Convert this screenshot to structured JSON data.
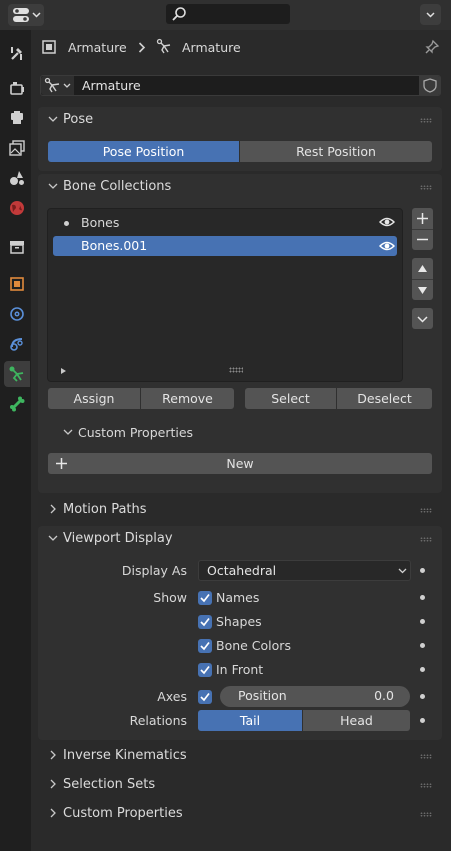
{
  "breadcrumb": {
    "object": "Armature",
    "data": "Armature"
  },
  "datablock": {
    "name": "Armature"
  },
  "pose": {
    "title": "Pose",
    "buttons": [
      "Pose Position",
      "Rest Position"
    ],
    "selected": "Pose Position"
  },
  "bone_collections": {
    "title": "Bone Collections",
    "items": [
      {
        "name": "Bones",
        "selected": false,
        "visible": true
      },
      {
        "name": "Bones.001",
        "selected": true,
        "visible": true
      }
    ],
    "assign_label": "Assign",
    "remove_label": "Remove",
    "select_label": "Select",
    "deselect_label": "Deselect",
    "custom_props_title": "Custom Properties",
    "new_label": "New"
  },
  "motion_paths": {
    "title": "Motion Paths"
  },
  "viewport_display": {
    "title": "Viewport Display",
    "display_as_label": "Display As",
    "display_as_value": "Octahedral",
    "show_label": "Show",
    "show_options": [
      {
        "label": "Names",
        "checked": true
      },
      {
        "label": "Shapes",
        "checked": true
      },
      {
        "label": "Bone Colors",
        "checked": true
      },
      {
        "label": "In Front",
        "checked": true
      }
    ],
    "axes_label": "Axes",
    "axes_checked": true,
    "position_label": "Position",
    "position_value": "0.0",
    "relations_label": "Relations",
    "relations_options": [
      "Tail",
      "Head"
    ],
    "relations_selected": "Tail"
  },
  "collapsed_panels": [
    "Inverse Kinematics",
    "Selection Sets",
    "Custom Properties"
  ],
  "colors": {
    "accent": "#4772b3",
    "bone_green": "#3eb55f",
    "button": "#545454",
    "panel": "#303030"
  }
}
